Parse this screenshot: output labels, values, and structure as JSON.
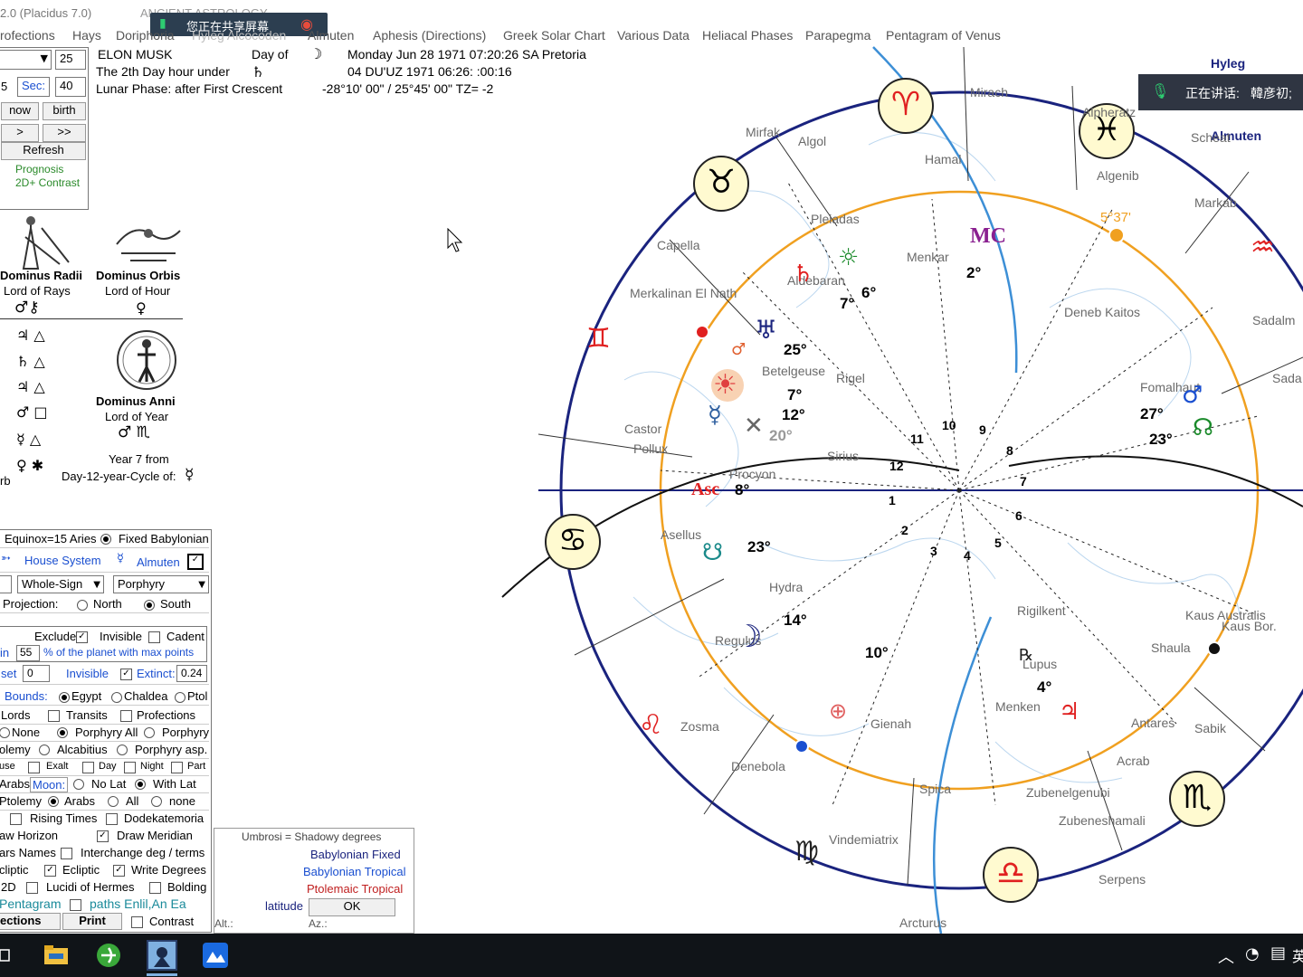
{
  "window": {
    "title_prefix": "2.0  (Placidus 7.0)",
    "title_app": "ANCIENT  ASTROLOGY"
  },
  "share_bar": {
    "label": "您正在共享屏幕"
  },
  "speaking": {
    "label": "正在讲话:",
    "name": "韓彦初;"
  },
  "menu": [
    "rofections",
    "Hays",
    "Doriphoria",
    "Hyleg Alcocoden",
    "Almuten",
    "Aphesis (Directions)",
    "Greek Solar Chart",
    "Various Data",
    "Heliacal Phases",
    "Parapegma",
    "Pentagram of Venus"
  ],
  "controls": {
    "spin_value": "25",
    "min_value": "5",
    "sec_label": "Sec:",
    "sec_value": "40",
    "now_btn": "now",
    "birth_btn": "birth",
    "prev_btn": ">",
    "next_btn": ">>",
    "refresh_btn": "Refresh",
    "prognosis": "Prognosis",
    "contrast_2d": "2D+ Contrast"
  },
  "chart_header": {
    "name": "ELON MUSK",
    "day_of_label": "Day of",
    "day_hour": "The 2th Day hour under",
    "lunar_phase": "Lunar Phase: after First Crescent",
    "date_line": "Monday  Jun 28 1971 07:20:26  SA Pretoria",
    "du_line": "04 DU'UZ 1971  06:26: :00:16",
    "coords_line": "-28°10' 00\" / 25°45' 00\"   TZ= -2"
  },
  "dominus": {
    "radii_title": "Dominus Radii",
    "radii_sub": "Lord of Rays",
    "orbis_title": "Dominus Orbis",
    "orbis_sub": "Lord of Hour",
    "anni_title": "Dominus Anni",
    "anni_sub": "Lord of Year",
    "year_from": "Year 7 from",
    "cycle": "Day-12-year-Cycle of:",
    "aspect_rows": [
      "♃ △",
      "♄ △",
      "♃ △",
      "♂ □",
      "☿ △",
      "♀ ✱"
    ]
  },
  "settings": {
    "equinox": "Equinox=15 Aries",
    "fixed_babylonian": "Fixed Babylonian",
    "house_system": "House System",
    "almuten": "Almuten",
    "whole_sign": "Whole-Sign",
    "porphyry": "Porphyry",
    "projection": "Projection:",
    "north": "North",
    "south": "South",
    "exclude": "Exclude",
    "invisible": "Invisible",
    "cadent": "Cadent",
    "min_label": "in",
    "min_value": "55",
    "pct_text": "% of the planet with max points",
    "set_label": "set",
    "set_value": "0",
    "invisible2": "Invisible",
    "extinct": "Extinct:",
    "extinct_value": "0.24",
    "bounds": "Bounds:",
    "egypt": "Egypt",
    "chaldea": "Chaldea",
    "ptol": "Ptol",
    "lords": "Lords",
    "transits": "Transits",
    "profections": "Profections",
    "none": "None",
    "porphyry_all": "Porphyry All",
    "porphyry2": "Porphyry",
    "olemy": "olemy",
    "alcabitius": "Alcabitius",
    "porphyry_asp": "Porphyry asp.",
    "use": "use",
    "exalt": "Exalt",
    "day": "Day",
    "night": "Night",
    "part": "Part",
    "arabs": "Arabs",
    "moon": "Moon:",
    "no_lat": "No Lat",
    "with_lat": "With Lat",
    "ptolemy": "Ptolemy",
    "arabs2": "Arabs",
    "all": "All",
    "none2": "none",
    "rising_times": "Rising Times",
    "dodekatemoria": "Dodekatemoria",
    "draw_horizon": "aw Horizon",
    "draw_meridian": "Draw Meridian",
    "stars_names": "ars Names",
    "interchange": "Interchange deg / terms",
    "ecliptic1": "cliptic",
    "ecliptic2": "Ecliptic",
    "write_degrees": "Write Degrees",
    "two_d": "2D",
    "lucidi": "Lucidi of Hermes",
    "bolding": "Bolding",
    "pentagram": "Pentagram",
    "paths": "paths Enlil,An Ea",
    "ections": "ections",
    "print": "Print",
    "contrast": "Contrast"
  },
  "umbra": {
    "title": "Umbrosi = Shadowy degrees",
    "fixed": "Babylonian Fixed",
    "tropical": "Babylonian Tropical",
    "ptolemaic": "Ptolemaic Tropical",
    "latitude": "latitude",
    "ok": "OK",
    "alt": "Alt.:",
    "az": "Az.:"
  },
  "wheel": {
    "hyleg": "Hyleg",
    "almuten": "Almuten",
    "mc": "MC",
    "asc": "Asc",
    "mc_degree": "5°37'",
    "house_numbers": [
      "1",
      "2",
      "3",
      "4",
      "5",
      "6",
      "7",
      "8",
      "9",
      "10",
      "11",
      "12"
    ],
    "stars": [
      "Mirach",
      "Mirfak",
      "Algol",
      "Hamal",
      "Scheat",
      "Algenib",
      "Markab",
      "Pleiadas",
      "Capella",
      "Menkar",
      "Aldebaran",
      "Merkalinan El Nath",
      "Deneb Kaitos",
      "Sadalm",
      "Betelgeuse",
      "Rigel",
      "Fomalhaut",
      "Sada",
      "Castor",
      "Pollux",
      "Sirius",
      "Procyon",
      "Asellus",
      "Hydra",
      "Rigilkent",
      "Kaus Australis",
      "Kaus Bor.",
      "Shaula",
      "Regulus",
      "Lupus",
      "Menken",
      "Antares",
      "Sabik",
      "Zosma",
      "Gienah",
      "Acrab",
      "Denebola",
      "Spica",
      "Zubenelgenubi",
      "Zubeneshamali",
      "Vindemiatrix",
      "Serpens",
      "Arcturus",
      "Alpheratz"
    ],
    "degrees": [
      "6°",
      "7°",
      "2°",
      "25°",
      "7°",
      "12°",
      "20°",
      "8°",
      "23°",
      "27°",
      "23°",
      "14°",
      "10°",
      "4°"
    ]
  },
  "colors": {
    "ring_blue": "#1a237e",
    "orange": "#f0a020",
    "sky_blue": "#3d8fd6",
    "red": "#e02020",
    "purple": "#8a2090",
    "teal": "#1a8a6a"
  }
}
